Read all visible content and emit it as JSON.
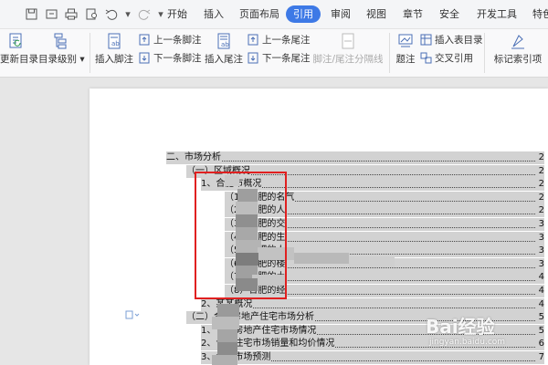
{
  "tabs": [
    "开始",
    "插入",
    "页面布局",
    "引用",
    "审阅",
    "视图",
    "章节",
    "安全",
    "开发工具",
    "特色"
  ],
  "active_tab": "引用",
  "ribbon": {
    "update_toc": "更新目录",
    "toc_level": "目录级别",
    "insert_footnote": "插入脚注",
    "prev_footnote": "上一条脚注",
    "next_footnote": "下一条脚注",
    "insert_endnote": "插入尾注",
    "prev_endnote": "上一条尾注",
    "next_endnote": "下一条尾注",
    "footnote_separator": "脚注/尾注分隔线",
    "caption": "题注",
    "insert_table_of_figures": "插入表目录",
    "cross_reference": "交叉引用",
    "mark_index": "标记索引项"
  },
  "toc": [
    {
      "text": "二、市场分析",
      "page": "2"
    },
    {
      "text": "（一）区域概况",
      "page": "2"
    },
    {
      "text": "1、合肥市概况",
      "page": "2"
    },
    {
      "text": "（1）合肥的名气",
      "page": "2"
    },
    {
      "text": "（2）合肥的人",
      "page": "2"
    },
    {
      "text": "（3）合肥的交",
      "page": "3"
    },
    {
      "text": "（4）合肥的生",
      "page": "3"
    },
    {
      "text": "（5）合肥的人",
      "page": "3"
    },
    {
      "text": "（6）合肥的楼",
      "page": "3"
    },
    {
      "text": "（7）合肥的土",
      "page": "4"
    },
    {
      "text": "（8）合肥的经",
      "page": "4"
    },
    {
      "text": "2、某某概况",
      "page": "4"
    },
    {
      "text": "（二）合肥房地产住宅市场分析",
      "page": "5"
    },
    {
      "text": "1、合肥房地产住宅市场情况",
      "page": "5"
    },
    {
      "text": "2、合肥住宅市场销量和均价情况",
      "page": "6"
    },
    {
      "text": "3、合肥市场预测",
      "page": "7"
    }
  ],
  "watermark": {
    "brand": "Bai经验",
    "url": "jingyan.baidu.com"
  }
}
